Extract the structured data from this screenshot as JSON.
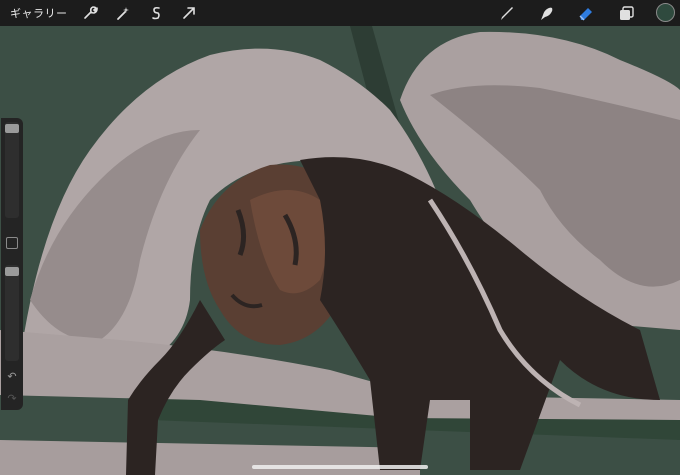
{
  "app": {
    "gallery_label": "ギャラリー"
  },
  "toolbar_left": [
    {
      "name": "actions",
      "icon": "wrench-icon"
    },
    {
      "name": "adjustments",
      "icon": "magic-wand-icon"
    },
    {
      "name": "selection",
      "icon": "selection-s-icon"
    },
    {
      "name": "transform",
      "icon": "arrow-cursor-icon"
    }
  ],
  "toolbar_right": [
    {
      "name": "brush",
      "icon": "brush-icon"
    },
    {
      "name": "smudge",
      "icon": "smudge-finger-icon"
    },
    {
      "name": "eraser",
      "icon": "eraser-icon",
      "active": true
    },
    {
      "name": "layers",
      "icon": "layers-icon"
    },
    {
      "name": "color",
      "icon": "color-swatch",
      "color": "#2f4a3e"
    }
  ],
  "sidebar": {
    "brush_size_level": 0.05,
    "opacity_level": 0.05,
    "undo_icon": "undo-arrow-icon",
    "redo_icon": "redo-arrow-icon"
  },
  "colors": {
    "background_green": "#3c4f45",
    "blanket_light": "#b0a6a6",
    "blanket_mid": "#918787",
    "skin": "#5a3f33",
    "hair": "#2c2422",
    "accent_blue": "#2f7de1"
  }
}
